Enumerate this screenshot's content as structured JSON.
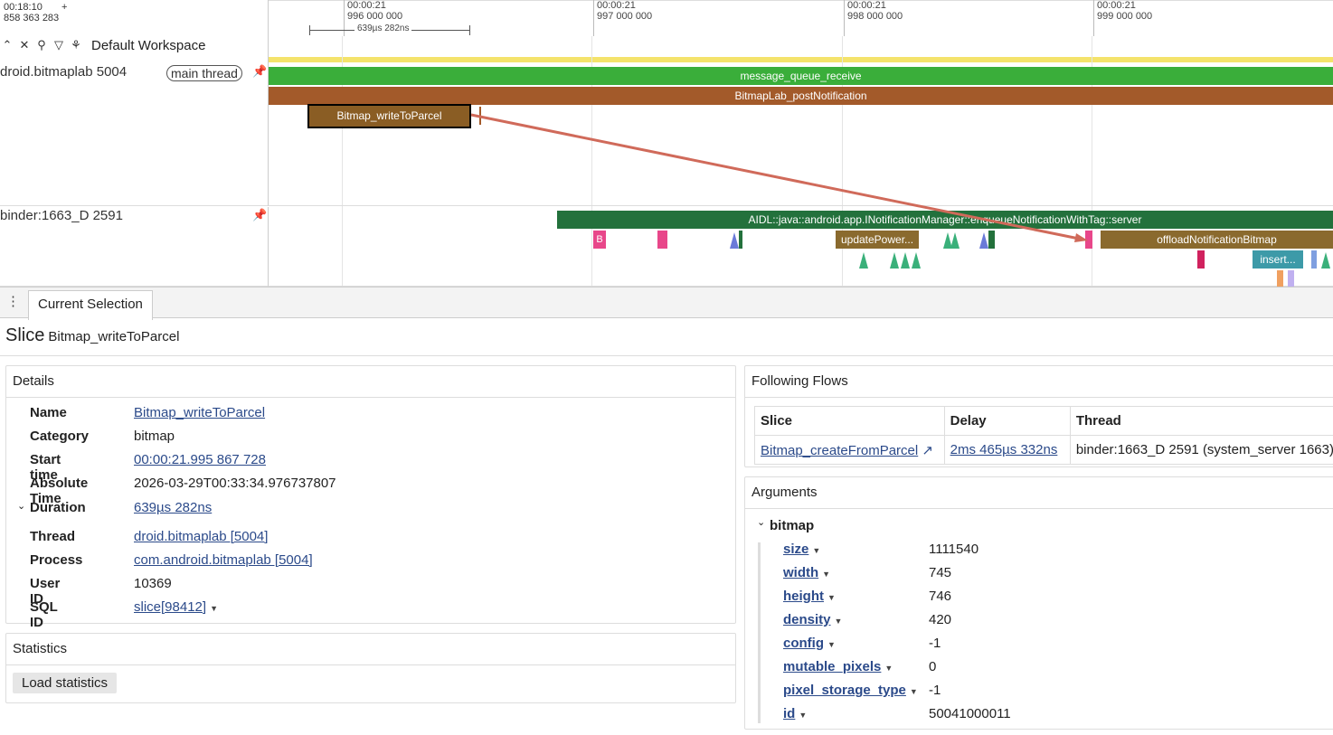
{
  "header": {
    "left_time_top": "00:18:10",
    "left_time_bottom": "858 363 283",
    "plus": "+",
    "workspace_label": "Default Workspace",
    "span_label": "639µs 282ns"
  },
  "timeline_ticks": [
    {
      "line1": "00:00:21",
      "line2": "996 000 000"
    },
    {
      "line1": "00:00:21",
      "line2": "997 000 000"
    },
    {
      "line1": "00:00:21",
      "line2": "998 000 000"
    },
    {
      "line1": "00:00:21",
      "line2": "999 000 000"
    }
  ],
  "tracks": [
    {
      "name": "droid.bitmaplab 5004",
      "chip": "main thread"
    },
    {
      "name": "binder:1663_D 2591"
    }
  ],
  "slices": {
    "message_queue_receive": "message_queue_receive",
    "postNotification": "BitmapLab_postNotification",
    "writeToParcel": "Bitmap_writeToParcel",
    "aidl": "AIDL::java::android.app.INotificationManager::enqueueNotificationWithTag::server",
    "updatePower": "updatePower...",
    "offload": "offloadNotificationBitmap",
    "insert": "insert...",
    "b_marker": "B"
  },
  "colors": {
    "green": "#3aae3a",
    "brown": "#a35a2a",
    "dark_green": "#23713c",
    "olive": "#8a6a2e",
    "pink": "#e8478a",
    "teal": "#3d9aa8",
    "flow_arrow": "#d06a5a"
  },
  "panel": {
    "tab": "Current Selection",
    "kind": "Slice",
    "selected": "Bitmap_writeToParcel"
  },
  "details": {
    "title": "Details",
    "rows": [
      {
        "k": "Name",
        "v": "Bitmap_writeToParcel"
      },
      {
        "k": "Category",
        "v": "bitmap"
      },
      {
        "k": "Start time",
        "v": "00:00:21.995 867 728"
      },
      {
        "k": "Absolute Time",
        "v": "2026-03-29T00:33:34.976737807"
      },
      {
        "k": "Duration",
        "v": "639µs 282ns"
      },
      {
        "k": "Thread",
        "v": "droid.bitmaplab [5004]"
      },
      {
        "k": "Process",
        "v": "com.android.bitmaplab [5004]"
      },
      {
        "k": "User ID",
        "v": "10369"
      },
      {
        "k": "SQL ID",
        "v": "slice[98412]"
      }
    ]
  },
  "statistics": {
    "title": "Statistics",
    "button": "Load statistics"
  },
  "flows": {
    "title": "Following Flows",
    "headers": [
      "Slice",
      "Delay",
      "Thread"
    ],
    "row": [
      "Bitmap_createFromParcel",
      "2ms 465µs 332ns",
      "binder:1663_D 2591 (system_server 1663)"
    ]
  },
  "arguments": {
    "title": "Arguments",
    "group": "bitmap",
    "items": [
      {
        "k": "size",
        "v": "1111540"
      },
      {
        "k": "width",
        "v": "745"
      },
      {
        "k": "height",
        "v": "746"
      },
      {
        "k": "density",
        "v": "420"
      },
      {
        "k": "config",
        "v": "-1"
      },
      {
        "k": "mutable_pixels",
        "v": "0"
      },
      {
        "k": "pixel_storage_type",
        "v": "-1"
      },
      {
        "k": "id",
        "v": "50041000011"
      }
    ]
  }
}
